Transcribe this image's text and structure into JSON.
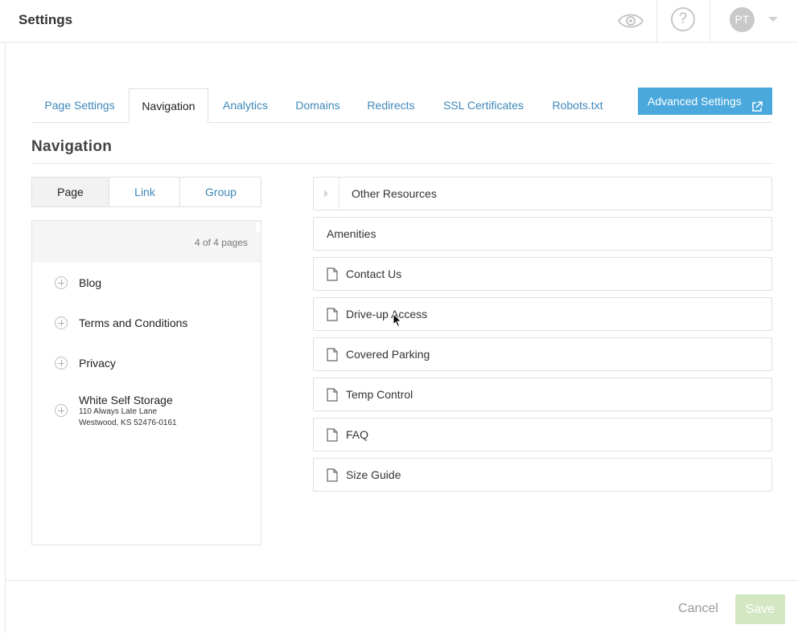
{
  "header": {
    "title": "Settings",
    "avatar_initials": "PT",
    "icons": [
      "eye-icon",
      "help-icon",
      "chevron-down-icon"
    ]
  },
  "tabs": [
    {
      "label": "Page Settings",
      "active": false
    },
    {
      "label": "Navigation",
      "active": true
    },
    {
      "label": "Analytics",
      "active": false
    },
    {
      "label": "Domains",
      "active": false
    },
    {
      "label": "Redirects",
      "active": false
    },
    {
      "label": "SSL Certificates",
      "active": false
    },
    {
      "label": "Robots.txt",
      "active": false
    }
  ],
  "advanced_button": {
    "label": "Advanced Settings",
    "icon": "external-link-icon"
  },
  "section_title": "Navigation",
  "segmented": {
    "items": [
      {
        "label": "Page",
        "active": true
      },
      {
        "label": "Link",
        "active": false
      },
      {
        "label": "Group",
        "active": false
      }
    ]
  },
  "page_list": {
    "count_label": "4 of 4 pages",
    "items": [
      {
        "label": "Blog"
      },
      {
        "label": "Terms and Conditions"
      },
      {
        "label": "Privacy"
      },
      {
        "label": "White Self Storage",
        "line2": "110 Always Late Lane",
        "line3": "Westwood, KS 52476-0161"
      }
    ]
  },
  "nav_items": [
    {
      "label": "Other Resources",
      "kind": "group"
    },
    {
      "label": "Amenities",
      "kind": "link"
    },
    {
      "label": "Contact Us",
      "kind": "page"
    },
    {
      "label": "Drive-up Access",
      "kind": "page"
    },
    {
      "label": "Covered Parking",
      "kind": "page"
    },
    {
      "label": "Temp Control",
      "kind": "page"
    },
    {
      "label": "FAQ",
      "kind": "page"
    },
    {
      "label": "Size Guide",
      "kind": "page"
    }
  ],
  "footer": {
    "cancel_label": "Cancel",
    "save_label": "Save"
  },
  "colors": {
    "link": "#3d87b9",
    "primary": "#4aa8dc",
    "save_disabled": "#d3e7c2"
  }
}
